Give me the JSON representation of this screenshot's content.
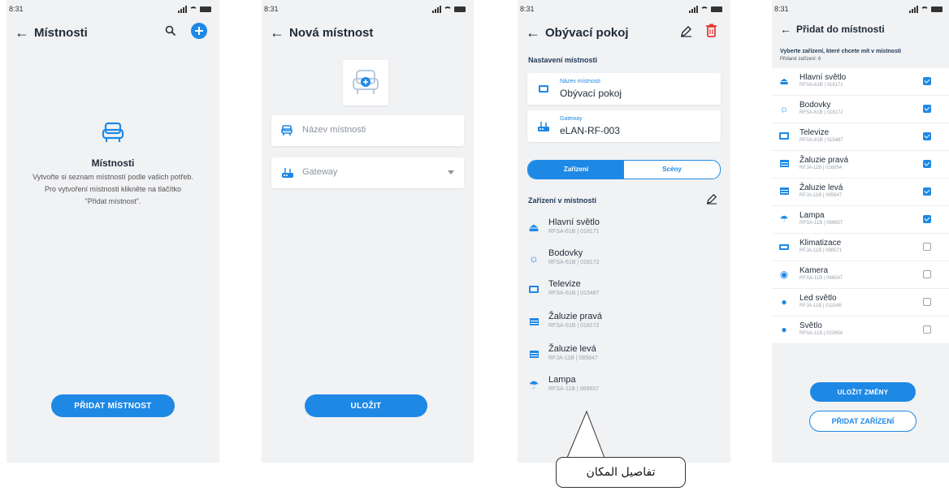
{
  "status_time": "8:31",
  "s1": {
    "title": "Místnosti",
    "empty_title": "Místnosti",
    "empty_line1": "Vytvořte si seznam místností podle vašich potřeb.",
    "empty_line2": "Pro vytvoření místnosti klikněte na tlačítko",
    "empty_line3": "\"Přidat místnost\".",
    "button": "PŘIDAT MÍSTNOST"
  },
  "s2": {
    "title": "Nová místnost",
    "name_placeholder": "Název místnosti",
    "gateway_placeholder": "Gateway",
    "button": "ULOŽIT"
  },
  "s3": {
    "title": "Obývací pokoj",
    "section_settings": "Nastavení místnosti",
    "field_name_label": "Název místnosti",
    "field_name_value": "Obývací pokoj",
    "field_gateway_label": "Gateway",
    "field_gateway_value": "eLAN-RF-003",
    "tab_devices": "Zařízení",
    "tab_scenes": "Scény",
    "section_devices": "Zařízení v místnosti",
    "devices": [
      {
        "name": "Hlavní světlo",
        "sub": "RFSA-61B  |  018171"
      },
      {
        "name": "Bodovky",
        "sub": "RFSA-61B  |  018172"
      },
      {
        "name": "Televize",
        "sub": "RFSA-61B  |  015487"
      },
      {
        "name": "Žaluzie pravá",
        "sub": "RFSA-61B  |  018172"
      },
      {
        "name": "Žaluzie levá",
        "sub": "RFJA-11B  |  065847"
      },
      {
        "name": "Lampa",
        "sub": "RFSA-11B  |  069657"
      }
    ]
  },
  "s4": {
    "title": "Přidat do místnosti",
    "instruction": "Vyberte zařízení, které chcete mít v místnosti",
    "added_count": "Přidané zařízení: 6",
    "devices": [
      {
        "name": "Hlavní světlo",
        "sub": "RFSA-61B  |  018171",
        "checked": true
      },
      {
        "name": "Bodovky",
        "sub": "RFSA-61B  |  018172",
        "checked": true
      },
      {
        "name": "Televize",
        "sub": "RFSA-61B  |  015487",
        "checked": true
      },
      {
        "name": "Žaluzie pravá",
        "sub": "RFJA-11B  |  016854",
        "checked": true
      },
      {
        "name": "Žaluzie levá",
        "sub": "RFJA-11B  |  065847",
        "checked": true
      },
      {
        "name": "Lampa",
        "sub": "RFSA-11B  |  069657",
        "checked": true
      },
      {
        "name": "Klimatizace",
        "sub": "RFJA-11B  |  098571",
        "checked": false
      },
      {
        "name": "Kamera",
        "sub": "RFSA-11B  |  066547",
        "checked": false
      },
      {
        "name": "Led světlo",
        "sub": "RFJA-11B  |  011546",
        "checked": false
      },
      {
        "name": "Světlo",
        "sub": "RFSA-11B  |  022654",
        "checked": false
      }
    ],
    "button_save": "ULOŽIT ZMĚNY",
    "button_add": "PŘIDAT ZAŘÍZENÍ"
  },
  "callout": "تفاصيل المكان",
  "colors": {
    "accent": "#1e88e5",
    "screen_bg": "#f1f2f4"
  }
}
